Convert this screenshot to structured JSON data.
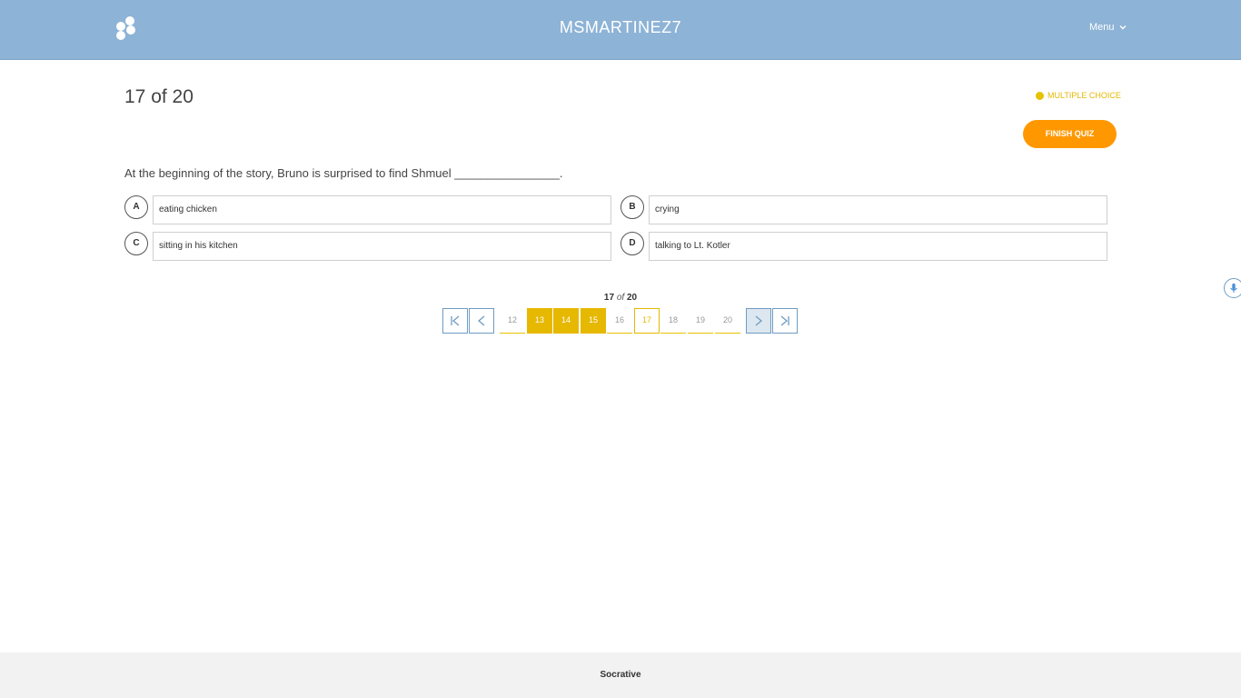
{
  "header": {
    "room_name": "MSMARTINEZ7",
    "menu_label": "Menu",
    "logo_icon": "socrative-logo-icon",
    "background": "#8db3d6"
  },
  "quiz": {
    "progress_title": "17 of 20",
    "question_type": "MULTIPLE CHOICE",
    "finish_label": "FINISH QUIZ",
    "question": "At the beginning of the story, Bruno is surprised to find Shmuel ________________.",
    "choices": [
      {
        "letter": "A",
        "text": "eating chicken"
      },
      {
        "letter": "B",
        "text": "crying"
      },
      {
        "letter": "C",
        "text": "sitting in his kitchen"
      },
      {
        "letter": "D",
        "text": "talking to Lt. Kotler"
      }
    ]
  },
  "pagination": {
    "current": "17",
    "of": "of",
    "total": "20",
    "pages": [
      {
        "num": "12",
        "state": "unanswered"
      },
      {
        "num": "13",
        "state": "answered"
      },
      {
        "num": "14",
        "state": "answered"
      },
      {
        "num": "15",
        "state": "answered"
      },
      {
        "num": "16",
        "state": "unanswered"
      },
      {
        "num": "17",
        "state": "current"
      },
      {
        "num": "18",
        "state": "unanswered"
      },
      {
        "num": "19",
        "state": "unanswered"
      },
      {
        "num": "20",
        "state": "unanswered"
      }
    ],
    "icons": [
      "first-page-icon",
      "previous-page-icon",
      "next-page-icon",
      "last-page-icon"
    ]
  },
  "footer": {
    "brand": "Socrative"
  },
  "colors": {
    "accent_orange": "#ff9800",
    "answered_yellow": "#e6b800",
    "nav_blue": "#6f9cc3"
  }
}
